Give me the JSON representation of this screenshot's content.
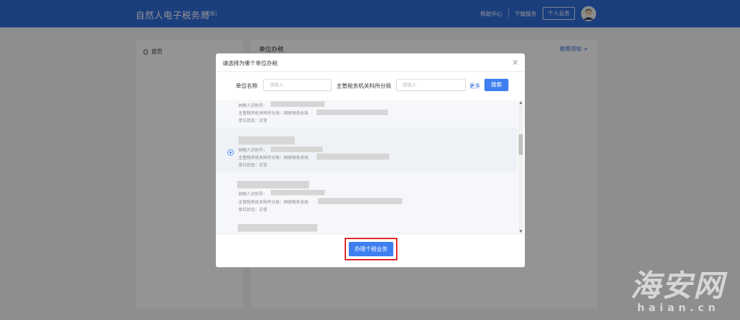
{
  "header": {
    "brand": "自然人电子税务局",
    "switch": "[切换]",
    "help": "帮助中心",
    "download": "下载服务",
    "personal": "个人业务"
  },
  "sidebar": {
    "home": "首页"
  },
  "main": {
    "title": "单位办税",
    "guide": "使用须知 >"
  },
  "modal": {
    "title": "请选择为哪个单位办税",
    "close": "×",
    "unit_label": "单位名称",
    "unit_placeholder": "请输入",
    "bureau_label": "主管税务机关科所分局",
    "bureau_placeholder": "请输入",
    "more": "更多",
    "search": "搜索",
    "submit": "办理个税业务",
    "items": [
      {
        "taxpayer_id_label": "纳税人识别号：",
        "bureau_label": "主管税务机关科所分局：国家税务总局",
        "status": "单位状态：正常",
        "selected": false
      },
      {
        "taxpayer_id_label": "纳税人识别号：",
        "bureau_label": "主管税务机关科所分局：国家税务总局",
        "status": "单位状态：正常",
        "selected": true
      },
      {
        "taxpayer_id_label": "纳税人识别号：",
        "bureau_label": "主管税务机关科所分局：国家税务总局",
        "status": "单位状态：正常",
        "selected": false
      }
    ]
  },
  "watermark": {
    "main": "海安网",
    "sub": "haian.cn"
  },
  "colors": {
    "primary": "#2f6bd8",
    "button": "#3d7ff0",
    "highlight": "#e02020"
  }
}
